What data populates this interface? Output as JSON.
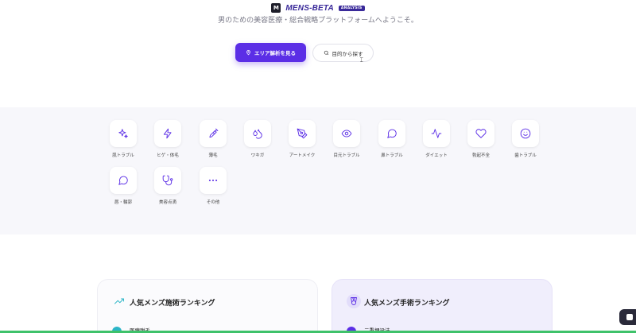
{
  "header": {
    "logo_mark": "M",
    "brand": "MENS-BETA",
    "badge": "ANALYSIS"
  },
  "hero": {
    "subtitle": "男のための美容医療・総合戦略プラットフォームへようこそ。",
    "primary_cta": "エリア解析を見る",
    "secondary_cta": "目的から探す",
    "accent_color": "#5b2ee6"
  },
  "categories": [
    {
      "label": "肌トラブル",
      "icon": "sparkles-icon"
    },
    {
      "label": "ヒゲ・体毛",
      "icon": "lightning-icon"
    },
    {
      "label": "薄毛",
      "icon": "syringe-icon"
    },
    {
      "label": "ワキガ",
      "icon": "droplets-icon"
    },
    {
      "label": "アートメイク",
      "icon": "pen-nib-icon"
    },
    {
      "label": "目元トラブル",
      "icon": "eye-icon"
    },
    {
      "label": "鼻トラブル",
      "icon": "speech-bubble-icon"
    },
    {
      "label": "ダイエット",
      "icon": "pulse-icon"
    },
    {
      "label": "勃起不全",
      "icon": "heart-icon"
    },
    {
      "label": "歯トラブル",
      "icon": "smile-icon"
    },
    {
      "label": "唇・輪郭",
      "icon": "chat-bubble-icon"
    },
    {
      "label": "美容点滴",
      "icon": "stethoscope-icon"
    },
    {
      "label": "その他",
      "icon": "more-dots-icon"
    }
  ],
  "rankings": {
    "treatment": {
      "title": "人気メンズ施術ランキング",
      "icon": "trending-up-icon",
      "first_item": "医療脱毛",
      "color": "#2bb5c7"
    },
    "surgery": {
      "title": "人気メンズ手術ランキング",
      "icon": "medal-icon",
      "first_item": "二重埋没法",
      "color": "#5b2ee6"
    }
  }
}
